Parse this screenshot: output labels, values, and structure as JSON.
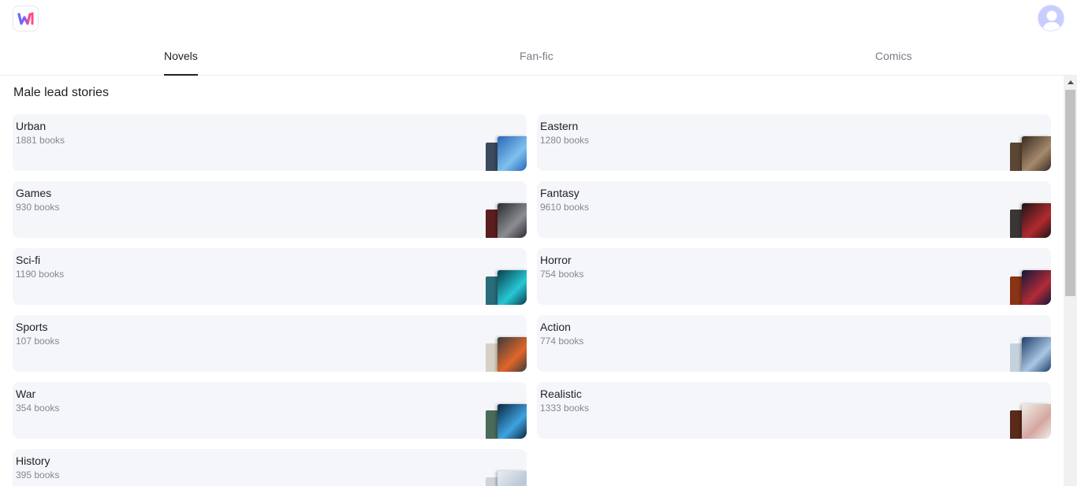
{
  "app": {
    "logo_icon": "brand-logo-icon",
    "avatar_icon": "user-avatar-icon"
  },
  "tabs": [
    {
      "label": "Novels",
      "active": true
    },
    {
      "label": "Fan-fic",
      "active": false
    },
    {
      "label": "Comics",
      "active": false
    }
  ],
  "section": {
    "title": "Male lead stories"
  },
  "categories": [
    {
      "name": "Urban",
      "count": "1881 books",
      "cover_colors": [
        "#2a66b8",
        "#7fc1ef"
      ],
      "back_color": "#3c4a5e"
    },
    {
      "name": "Eastern",
      "count": "1280 books",
      "cover_colors": [
        "#3a2a22",
        "#a58a6c"
      ],
      "back_color": "#5a4632"
    },
    {
      "name": "Games",
      "count": "930 books",
      "cover_colors": [
        "#2b2b2e",
        "#8b8d93"
      ],
      "back_color": "#5b1e1e"
    },
    {
      "name": "Fantasy",
      "count": "9610 books",
      "cover_colors": [
        "#1e1416",
        "#b12a2f"
      ],
      "back_color": "#3b3535"
    },
    {
      "name": "Sci-fi",
      "count": "1190 books",
      "cover_colors": [
        "#0a3f4a",
        "#27c7d6"
      ],
      "back_color": "#2a6c7a"
    },
    {
      "name": "Horror",
      "count": "754 books",
      "cover_colors": [
        "#12183c",
        "#b32a36"
      ],
      "back_color": "#8a3316"
    },
    {
      "name": "Sports",
      "count": "107 books",
      "cover_colors": [
        "#3b3b3b",
        "#e0662a"
      ],
      "back_color": "#d8d0c4"
    },
    {
      "name": "Action",
      "count": "774 books",
      "cover_colors": [
        "#1b3e6a",
        "#a9c6e4"
      ],
      "back_color": "#c5d2de"
    },
    {
      "name": "War",
      "count": "354 books",
      "cover_colors": [
        "#0a2640",
        "#3fa3e0"
      ],
      "back_color": "#4a6a5a"
    },
    {
      "name": "Realistic",
      "count": "1333 books",
      "cover_colors": [
        "#f1ede8",
        "#d4a7a0"
      ],
      "back_color": "#5a2a1a"
    },
    {
      "name": "History",
      "count": "395 books",
      "cover_colors": [
        "#e8edf3",
        "#b9c7d6"
      ],
      "back_color": "#d0d4d8"
    }
  ]
}
